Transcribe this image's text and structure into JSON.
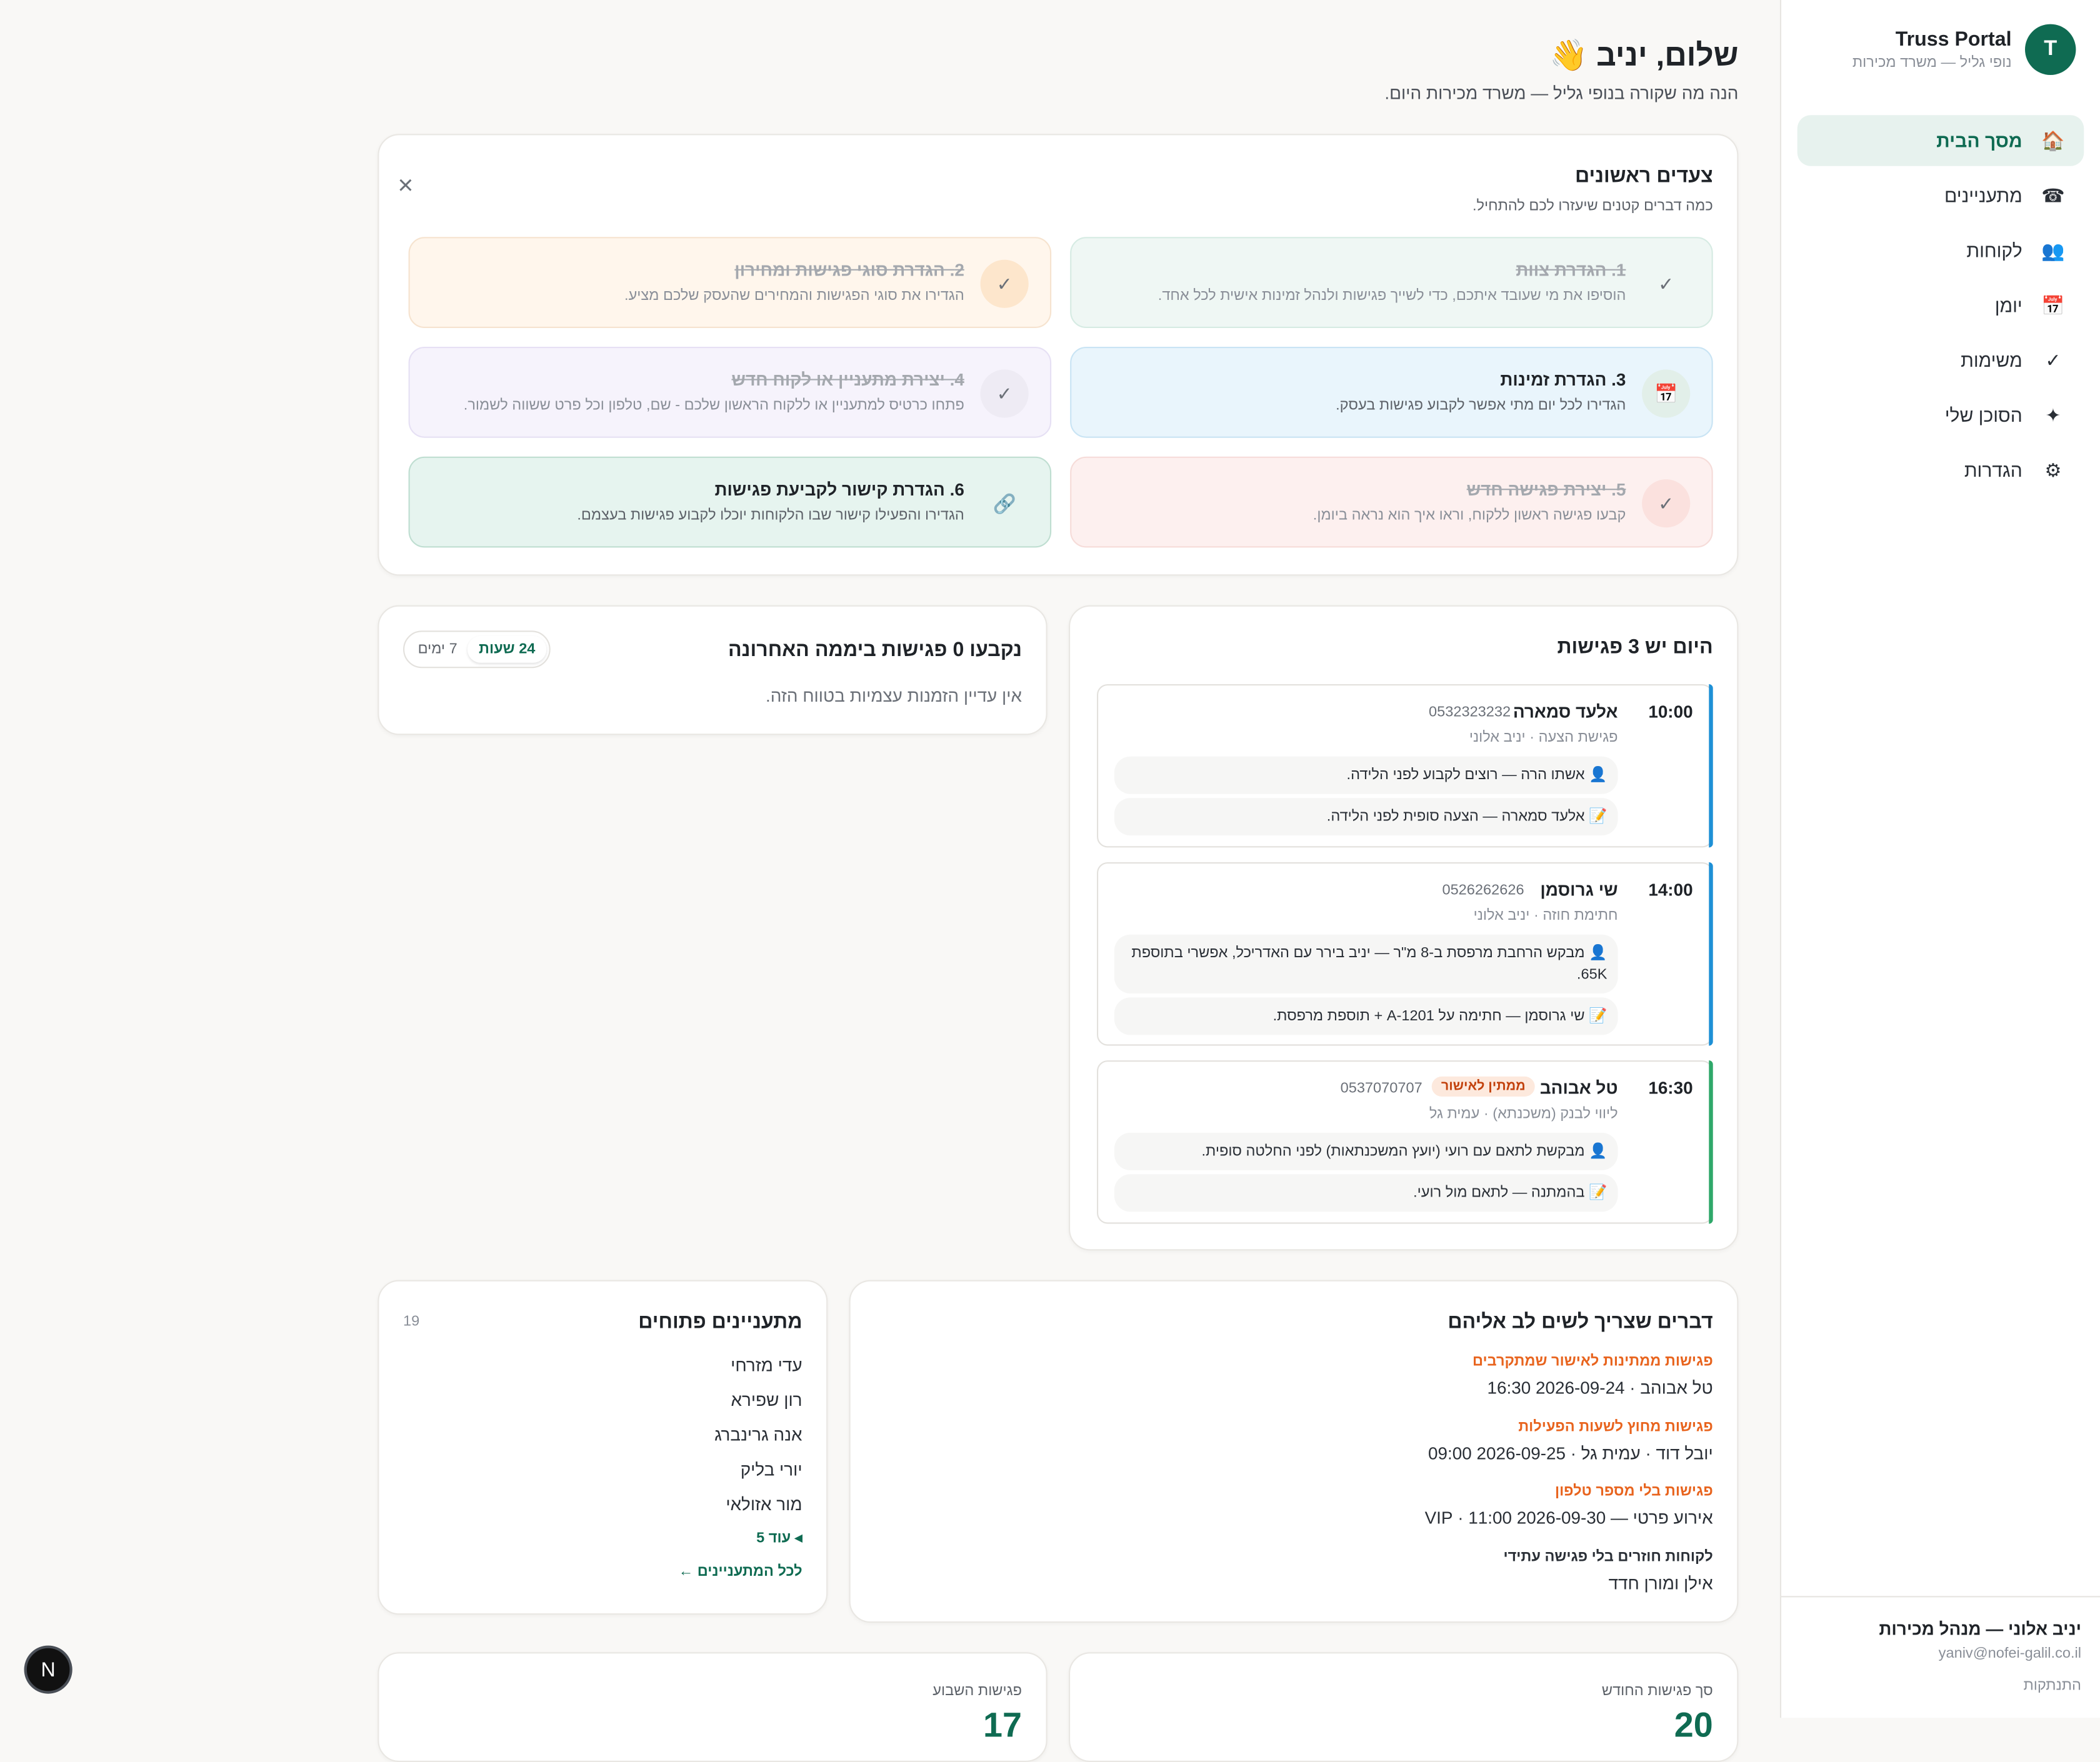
{
  "brand": {
    "avatar_letter": "T",
    "title": "Truss Portal",
    "subtitle": "נופי גליל — משרד מכירות"
  },
  "nav": [
    {
      "label": "מסך הבית",
      "icon": "🏠",
      "active": true
    },
    {
      "label": "מתעניינים",
      "icon": "☎"
    },
    {
      "label": "לקוחות",
      "icon": "👥"
    },
    {
      "label": "יומן",
      "icon": "📅"
    },
    {
      "label": "משימות",
      "icon": "✓"
    },
    {
      "label": "הסוכן שלי",
      "icon": "✦"
    },
    {
      "label": "הגדרות",
      "icon": "⚙"
    }
  ],
  "user": {
    "name": "יניב אלוני — מנהל מכירות",
    "email": "yaniv@nofei-galil.co.il",
    "logout": "התנתקות"
  },
  "header": {
    "greeting": "שלום, יניב 👋",
    "subtitle": "הנה מה שקורה בנופי גליל — משרד מכירות היום."
  },
  "onboarding": {
    "title": "צעדים ראשונים",
    "subtitle": "כמה דברים קטנים שיעזרו לכם להתחיל.",
    "steps": [
      {
        "title": "1. הגדרת צוות",
        "desc": "הוסיפו את מי שעובד איתכם, כדי לשייך פגישות ולנהל זמינות אישית לכל אחד.",
        "done": true,
        "icon": "check-icon",
        "glyph": "✓"
      },
      {
        "title": "2. הגדרת סוגי פגישות ומחירון",
        "desc": "הגדירו את סוגי הפגישות והמחירים שהעסק שלכם מציע.",
        "done": true,
        "icon": "check-icon",
        "glyph": "✓"
      },
      {
        "title": "3. הגדרת זמינות",
        "desc": "הגדירו לכל יום מתי אפשר לקבוע פגישות בעסק.",
        "done": false,
        "icon": "calendar-icon",
        "glyph": "📅"
      },
      {
        "title": "4. יצירת מתעניין או לקוח חדש",
        "desc": "פתחו כרטיס למתעניין או ללקוח הראשון שלכם - שם, טלפון וכל פרט ששווה לשמור.",
        "done": true,
        "icon": "check-icon",
        "glyph": "✓"
      },
      {
        "title": "5. יצירת פגישה חדש",
        "desc": "קבעו פגישה ראשון ללקוח, וראו איך הוא נראה ביומן.",
        "done": true,
        "icon": "check-icon",
        "glyph": "✓"
      },
      {
        "title": "6. הגדרת קישור לקביעת פגישות",
        "desc": "הגדירו והפעילו קישור שבו הלקוחות יוכלו לקבוע פגישות בעצמם.",
        "done": false,
        "icon": "link-icon",
        "glyph": "🔗"
      }
    ],
    "colors": {
      "teal": "#eff7f4",
      "orange": "#fff6ec",
      "blue": "#e9f5fc",
      "purple": "#f6f3fc",
      "red": "#fdf0ef",
      "green": "#e6f4ef"
    }
  },
  "today": {
    "title": "היום יש 3 פגישות",
    "meetings": [
      {
        "time": "10:00",
        "name": "אלעד סמארה",
        "phone": "0532323232",
        "type": "פגישת הצעה · יניב אלוני",
        "notes": [
          "👤 אשתו הרה — רוצים לקבוע לפני הלידה.",
          "📝 אלעד סמארה — הצעה סופית לפני הלידה."
        ],
        "bar_color": "#1e90d6"
      },
      {
        "time": "14:00",
        "name": "שי גרוסמן",
        "phone": "0526262626",
        "type": "חתימת חוזה · יניב אלוני",
        "notes": [
          "👤 מבקש הרחבת מרפסת ב-8 מ\"ר — יניב בירר עם האדריכל, אפשרי בתוספת 65K.",
          "📝 שי גרוסמן — חתימה על A-1201 + תוספת מרפסת."
        ],
        "bar_color": "#1e90d6"
      },
      {
        "time": "16:30",
        "name": "טל אבוהב",
        "phone": "0537070707",
        "badge": "ממתין לאישור",
        "type": "ליווי לבנק (משכנתא) · עמית גל",
        "notes": [
          "👤 מבקשת לתאם עם רועי (יועץ המשכנתאות) לפני החלטה סופית.",
          "📝 בהמתנה — לתאם מול רועי."
        ],
        "bar_color": "#2fa86a"
      }
    ]
  },
  "self_booked": {
    "title": "נקבעו 0 פגישות ביממה האחרונה",
    "empty": "אין עדיין הזמנות עצמיות בטווח הזה.",
    "options": [
      "24 שעות",
      "7 ימים"
    ],
    "selected": "24 שעות"
  },
  "attention": {
    "title": "דברים שצריך לשים לב אליהם",
    "items": [
      {
        "label": "פגישות ממתינות לאישור שמתקרבים",
        "value": "טל אבוהב · 2026-09-24 16:30",
        "warn": true
      },
      {
        "label": "פגישות מחוץ לשעות הפעילות",
        "value": "יובל דוד · עמית גל · 2026-09-25 09:00",
        "warn": true
      },
      {
        "label": "פגישות בלי מספר טלפון",
        "value": "אירוע פרטי — 2026-09-30 11:00 · VIP",
        "warn": true
      },
      {
        "label": "לקוחות חוזרים בלי פגישה עתידי",
        "value": "אילן ומורן חדד",
        "warn": false
      }
    ]
  },
  "leads": {
    "title": "מתעניינים פתוחים",
    "count": "19",
    "names": [
      "עדי מזרחי",
      "רון שפירא",
      "אנה גרינברג",
      "יורי בליק",
      "מור אזולאי"
    ],
    "more": "◂ עוד 5",
    "all_link": "לכל המתעניינים ←"
  },
  "stats": [
    {
      "label": "סך פגישות החודש",
      "value": "20"
    },
    {
      "label": "פגישות השבוע",
      "value": "17"
    }
  ],
  "devtools": {
    "letter": "N"
  }
}
